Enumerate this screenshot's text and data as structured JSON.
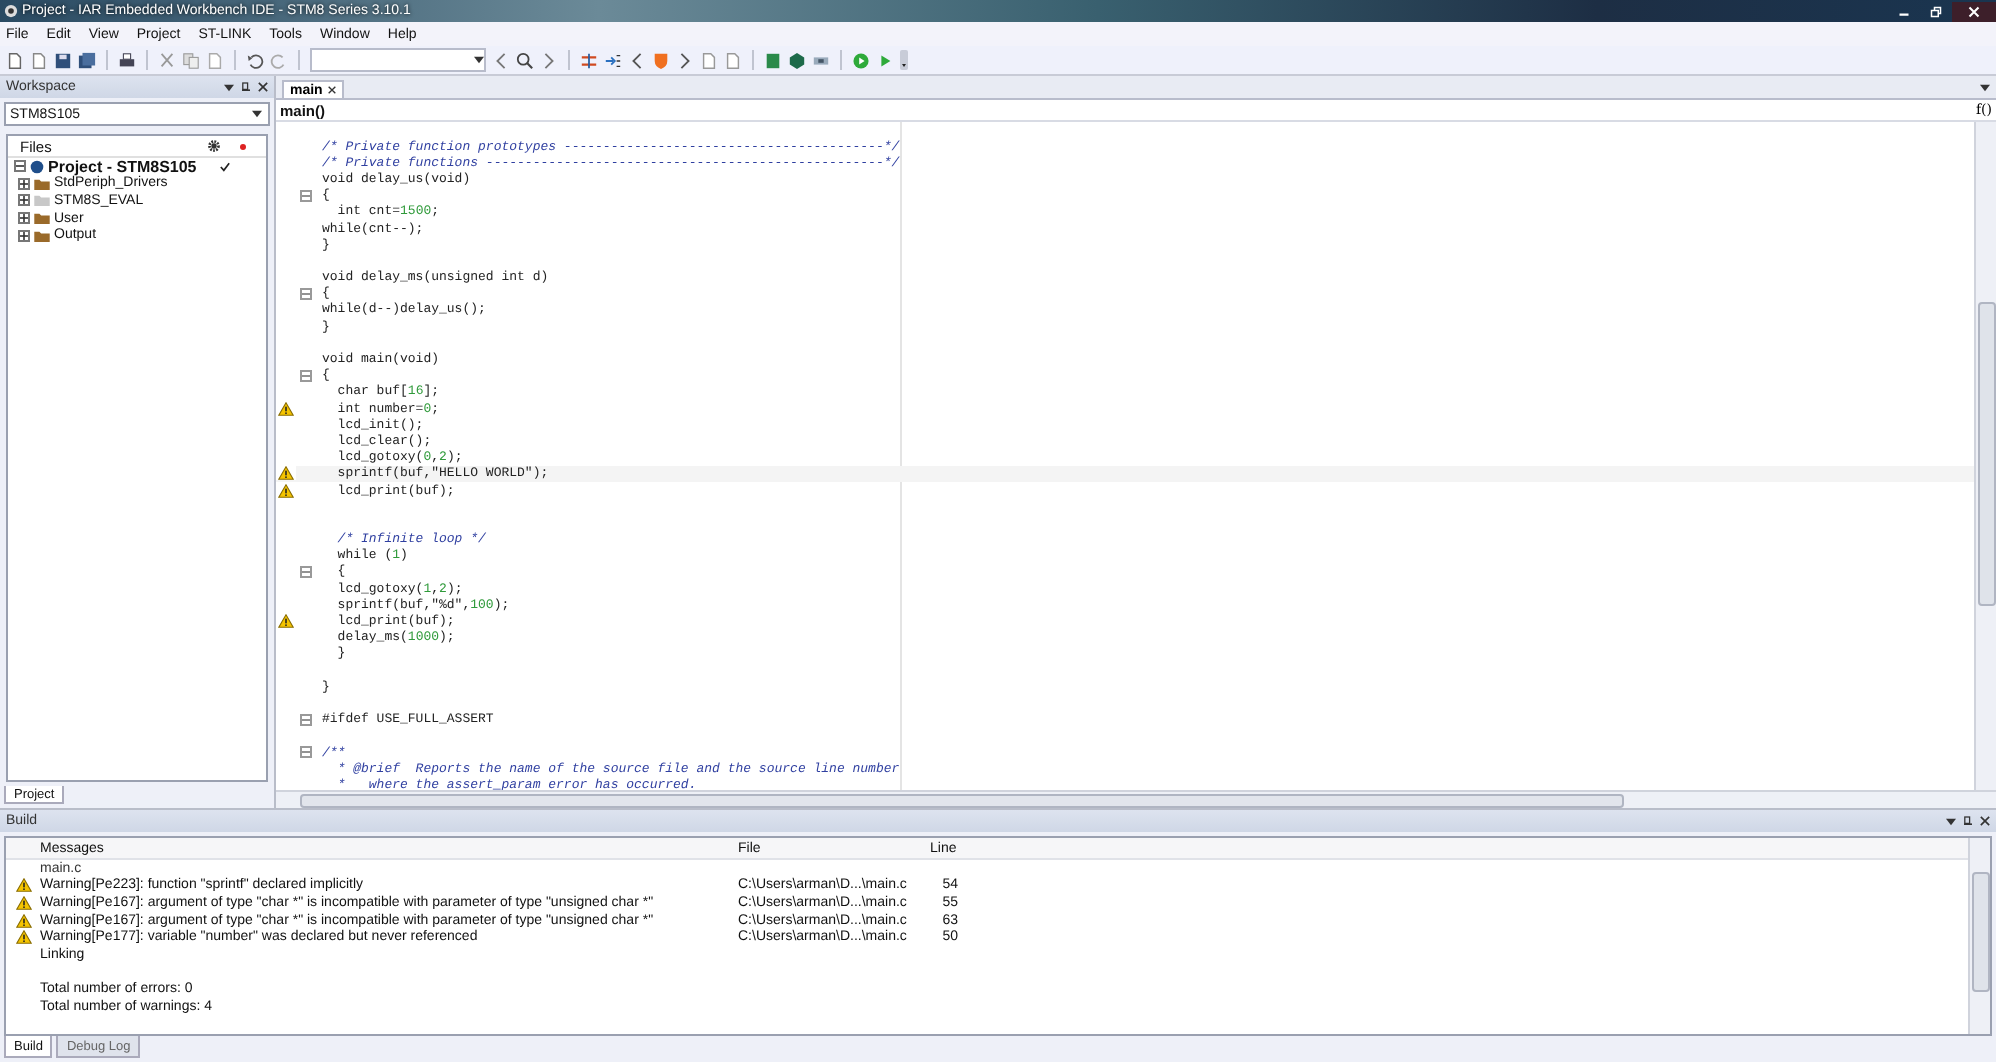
{
  "window": {
    "title": "Project - IAR Embedded Workbench IDE - STM8 Series 3.10.1"
  },
  "menu": [
    "File",
    "Edit",
    "View",
    "Project",
    "ST-LINK",
    "Tools",
    "Window",
    "Help"
  ],
  "workspace": {
    "title": "Workspace",
    "configuration": "STM8S105",
    "files_header": "Files",
    "tree": [
      {
        "label": "Project - STM8S105",
        "kind": "project",
        "expanded": true,
        "checked": true,
        "children": [
          {
            "label": "StdPeriph_Drivers",
            "kind": "folder",
            "expanded": false,
            "checked": false
          },
          {
            "label": "STM8S_EVAL",
            "kind": "excluded-folder",
            "expanded": false,
            "checked": false
          },
          {
            "label": "User",
            "kind": "folder",
            "expanded": false,
            "checked": false
          },
          {
            "label": "Output",
            "kind": "folder",
            "expanded": false,
            "checked": false
          }
        ]
      }
    ],
    "tabs": [
      {
        "label": "Project",
        "selected": true
      }
    ]
  },
  "editor": {
    "tabs": [
      {
        "label": "main",
        "selected": true
      }
    ],
    "function_nav": "main()",
    "function_button": "f()",
    "lines": [
      {
        "warning": false,
        "current": false,
        "collapsible": false,
        "parts": [
          {
            "text": "/* Private function prototypes -----------------------------------------*/",
            "kind": "comment"
          }
        ]
      },
      {
        "warning": false,
        "current": false,
        "collapsible": false,
        "parts": [
          {
            "text": "/* Private functions ---------------------------------------------------*/",
            "kind": "comment"
          }
        ]
      },
      {
        "warning": false,
        "current": false,
        "collapsible": false,
        "parts": [
          {
            "text": "void delay_us(void)",
            "kind": "plain"
          }
        ]
      },
      {
        "warning": false,
        "current": false,
        "collapsible": true,
        "parts": [
          {
            "text": "{",
            "kind": "plain"
          }
        ]
      },
      {
        "warning": false,
        "current": false,
        "collapsible": false,
        "parts": [
          {
            "text": "  int cnt=",
            "kind": "plain"
          },
          {
            "text": "1500",
            "kind": "number"
          },
          {
            "text": ";",
            "kind": "plain"
          }
        ]
      },
      {
        "warning": false,
        "current": false,
        "collapsible": false,
        "parts": [
          {
            "text": "while(cnt--);",
            "kind": "plain"
          }
        ]
      },
      {
        "warning": false,
        "current": false,
        "collapsible": false,
        "parts": [
          {
            "text": "}",
            "kind": "plain"
          }
        ]
      },
      {
        "warning": false,
        "current": false,
        "collapsible": false
      },
      {
        "warning": false,
        "current": false,
        "collapsible": false,
        "parts": [
          {
            "text": "void delay_ms(unsigned int d)",
            "kind": "plain"
          }
        ]
      },
      {
        "warning": false,
        "current": false,
        "collapsible": true,
        "parts": [
          {
            "text": "{",
            "kind": "plain"
          }
        ]
      },
      {
        "warning": false,
        "current": false,
        "collapsible": false,
        "parts": [
          {
            "text": "while(d--)delay_us();",
            "kind": "plain"
          }
        ]
      },
      {
        "warning": false,
        "current": false,
        "collapsible": false,
        "parts": [
          {
            "text": "}",
            "kind": "plain"
          }
        ]
      },
      {
        "warning": false,
        "current": false,
        "collapsible": false
      },
      {
        "warning": false,
        "current": false,
        "collapsible": false,
        "parts": [
          {
            "text": "void main(void)",
            "kind": "plain"
          }
        ]
      },
      {
        "warning": false,
        "current": false,
        "collapsible": true,
        "parts": [
          {
            "text": "{",
            "kind": "plain"
          }
        ]
      },
      {
        "warning": false,
        "current": false,
        "collapsible": false,
        "parts": [
          {
            "text": "  char buf[",
            "kind": "plain"
          },
          {
            "text": "16",
            "kind": "number"
          },
          {
            "text": "];",
            "kind": "plain"
          }
        ]
      },
      {
        "warning": true,
        "current": false,
        "collapsible": false,
        "parts": [
          {
            "text": "  int number=",
            "kind": "plain"
          },
          {
            "text": "0",
            "kind": "number"
          },
          {
            "text": ";",
            "kind": "plain"
          }
        ]
      },
      {
        "warning": false,
        "current": false,
        "collapsible": false,
        "parts": [
          {
            "text": "  lcd_init();",
            "kind": "plain"
          }
        ]
      },
      {
        "warning": false,
        "current": false,
        "collapsible": false,
        "parts": [
          {
            "text": "  lcd_clear();",
            "kind": "plain"
          }
        ]
      },
      {
        "warning": false,
        "current": false,
        "collapsible": false,
        "parts": [
          {
            "text": "  lcd_gotoxy(",
            "kind": "plain"
          },
          {
            "text": "0",
            "kind": "number"
          },
          {
            "text": ",",
            "kind": "plain"
          },
          {
            "text": "2",
            "kind": "number"
          },
          {
            "text": ");",
            "kind": "plain"
          }
        ]
      },
      {
        "warning": true,
        "current": true,
        "collapsible": false,
        "parts": [
          {
            "text": "  sprintf(buf,\"HELLO WORLD\");",
            "kind": "plain"
          }
        ]
      },
      {
        "warning": true,
        "current": false,
        "collapsible": false,
        "parts": [
          {
            "text": "  lcd_print(buf);",
            "kind": "plain"
          }
        ]
      },
      {
        "warning": false,
        "current": false,
        "collapsible": false
      },
      {
        "warning": false,
        "current": false,
        "collapsible": false
      },
      {
        "warning": false,
        "current": false,
        "collapsible": false,
        "parts": [
          {
            "text": "  /* Infinite loop */",
            "kind": "comment"
          }
        ]
      },
      {
        "warning": false,
        "current": false,
        "collapsible": false,
        "parts": [
          {
            "text": "  while (",
            "kind": "plain"
          },
          {
            "text": "1",
            "kind": "number"
          },
          {
            "text": ")",
            "kind": "plain"
          }
        ]
      },
      {
        "warning": false,
        "current": false,
        "collapsible": true,
        "parts": [
          {
            "text": "  {",
            "kind": "plain"
          }
        ]
      },
      {
        "warning": false,
        "current": false,
        "collapsible": false,
        "parts": [
          {
            "text": "  lcd_gotoxy(",
            "kind": "plain"
          },
          {
            "text": "1",
            "kind": "number"
          },
          {
            "text": ",",
            "kind": "plain"
          },
          {
            "text": "2",
            "kind": "number"
          },
          {
            "text": ");",
            "kind": "plain"
          }
        ]
      },
      {
        "warning": false,
        "current": false,
        "collapsible": false,
        "parts": [
          {
            "text": "  sprintf(buf,\"%d\",",
            "kind": "plain"
          },
          {
            "text": "100",
            "kind": "number"
          },
          {
            "text": ");",
            "kind": "plain"
          }
        ]
      },
      {
        "warning": true,
        "current": false,
        "collapsible": false,
        "parts": [
          {
            "text": "  lcd_print(buf);",
            "kind": "plain"
          }
        ]
      },
      {
        "warning": false,
        "current": false,
        "collapsible": false,
        "parts": [
          {
            "text": "  delay_ms(",
            "kind": "plain"
          },
          {
            "text": "1000",
            "kind": "number"
          },
          {
            "text": ");",
            "kind": "plain"
          }
        ]
      },
      {
        "warning": false,
        "current": false,
        "collapsible": false,
        "parts": [
          {
            "text": "  }",
            "kind": "plain"
          }
        ]
      },
      {
        "warning": false,
        "current": false,
        "collapsible": false
      },
      {
        "warning": false,
        "current": false,
        "collapsible": false,
        "parts": [
          {
            "text": "}",
            "kind": "plain"
          }
        ]
      },
      {
        "warning": false,
        "current": false,
        "collapsible": false
      },
      {
        "warning": false,
        "current": false,
        "collapsible": true,
        "parts": [
          {
            "text": "#ifdef USE_FULL_ASSERT",
            "kind": "plain"
          }
        ]
      },
      {
        "warning": false,
        "current": false,
        "collapsible": false
      },
      {
        "warning": false,
        "current": false,
        "collapsible": true,
        "parts": [
          {
            "text": "/**",
            "kind": "comment"
          }
        ]
      },
      {
        "warning": false,
        "current": false,
        "collapsible": false,
        "parts": [
          {
            "text": "  * @brief  Reports the name of the source file and the source line number",
            "kind": "comment"
          }
        ]
      },
      {
        "warning": false,
        "current": false,
        "collapsible": false,
        "parts": [
          {
            "text": "  *   where the assert_param error has occurred.",
            "kind": "comment"
          }
        ]
      }
    ]
  },
  "build": {
    "title": "Build",
    "columns": [
      "Messages",
      "File",
      "Line"
    ],
    "rows": [
      {
        "kind": "file",
        "message": "main.c"
      },
      {
        "kind": "warning",
        "message": "Warning[Pe223]: function \"sprintf\" declared implicitly",
        "file": "C:\\Users\\arman\\D...\\main.c",
        "line": "54"
      },
      {
        "kind": "warning",
        "message": "Warning[Pe167]: argument of type \"char *\" is incompatible with parameter of type \"unsigned char *\"",
        "file": "C:\\Users\\arman\\D...\\main.c",
        "line": "55"
      },
      {
        "kind": "warning",
        "message": "Warning[Pe167]: argument of type \"char *\" is incompatible with parameter of type \"unsigned char *\"",
        "file": "C:\\Users\\arman\\D...\\main.c",
        "line": "63"
      },
      {
        "kind": "warning",
        "message": "Warning[Pe177]: variable \"number\" was declared but never referenced",
        "file": "C:\\Users\\arman\\D...\\main.c",
        "line": "50"
      },
      {
        "kind": "info",
        "message": "Linking"
      },
      {
        "kind": "spacer"
      },
      {
        "kind": "info",
        "message": "Total number of errors: 0"
      },
      {
        "kind": "info",
        "message": "Total number of warnings: 4"
      }
    ]
  },
  "bottom_tabs": [
    {
      "label": "Build",
      "selected": true
    },
    {
      "label": "Debug Log",
      "selected": false
    }
  ]
}
